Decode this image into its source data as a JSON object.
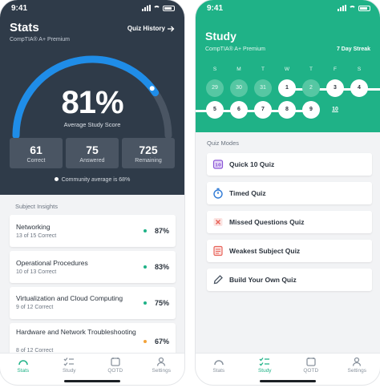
{
  "stats_screen": {
    "status_time": "9:41",
    "title": "Stats",
    "subtitle": "CompTIA® A+ Premium",
    "quiz_history_label": "Quiz History",
    "score_percent": 81,
    "score_text": "81%",
    "score_label": "Average Study Score",
    "stats": [
      {
        "value": "61",
        "label": "Correct"
      },
      {
        "value": "75",
        "label": "Answered"
      },
      {
        "value": "725",
        "label": "Remaining"
      }
    ],
    "community_text": "Community average is 68%",
    "insights_title": "Subject Insights",
    "subjects": [
      {
        "name": "Networking",
        "correct": "13 of 15 Correct",
        "percent": "87%",
        "dot_color": "#1fb287"
      },
      {
        "name": "Operational Procedures",
        "correct": "10 of 13 Correct",
        "percent": "83%",
        "dot_color": "#1fb287"
      },
      {
        "name": "Virtualization and Cloud Computing",
        "correct": "9 of 12 Correct",
        "percent": "75%",
        "dot_color": "#1fb287"
      },
      {
        "name": "Hardware and Network Troubleshooting",
        "correct": "8 of 12 Correct",
        "percent": "67%",
        "dot_color": "#f2a33a"
      }
    ]
  },
  "study_screen": {
    "status_time": "9:41",
    "title": "Study",
    "subtitle": "CompTIA® A+ Premium",
    "streak_label": "7 Day Streak",
    "weekdays": [
      "S",
      "M",
      "T",
      "W",
      "T",
      "F",
      "S"
    ],
    "week1": [
      {
        "day": "29",
        "state": "past"
      },
      {
        "day": "30",
        "state": "past"
      },
      {
        "day": "31",
        "state": "past"
      },
      {
        "day": "1",
        "state": "done"
      },
      {
        "day": "2",
        "state": "past"
      },
      {
        "day": "3",
        "state": "done"
      },
      {
        "day": "4",
        "state": "done"
      }
    ],
    "week2": [
      {
        "day": "5",
        "state": "done"
      },
      {
        "day": "6",
        "state": "done"
      },
      {
        "day": "7",
        "state": "done"
      },
      {
        "day": "8",
        "state": "done"
      },
      {
        "day": "9",
        "state": "done"
      },
      {
        "day": "10",
        "state": "today"
      }
    ],
    "modes_title": "Quiz Modes",
    "modes": [
      {
        "label": "Quick 10 Quiz",
        "icon": "quick-quiz-icon",
        "color": "#8a55d6"
      },
      {
        "label": "Timed Quiz",
        "icon": "stopwatch-icon",
        "color": "#2f7ad6"
      },
      {
        "label": "Missed Questions Quiz",
        "icon": "missed-icon",
        "color": "#e8645a"
      },
      {
        "label": "Weakest Subject Quiz",
        "icon": "weakest-icon",
        "color": "#e8645a"
      },
      {
        "label": "Build Your Own Quiz",
        "icon": "pencil-icon",
        "color": "#4a5563"
      }
    ]
  },
  "tabs": [
    {
      "label": "Stats",
      "icon": "gauge-icon"
    },
    {
      "label": "Study",
      "icon": "checklist-icon"
    },
    {
      "label": "QOTD",
      "icon": "calendar-icon"
    },
    {
      "label": "Settings",
      "icon": "person-icon"
    }
  ],
  "colors": {
    "stats_header": "#2f3b49",
    "study_green": "#1fb287",
    "gauge_blue": "#1f8de8"
  }
}
